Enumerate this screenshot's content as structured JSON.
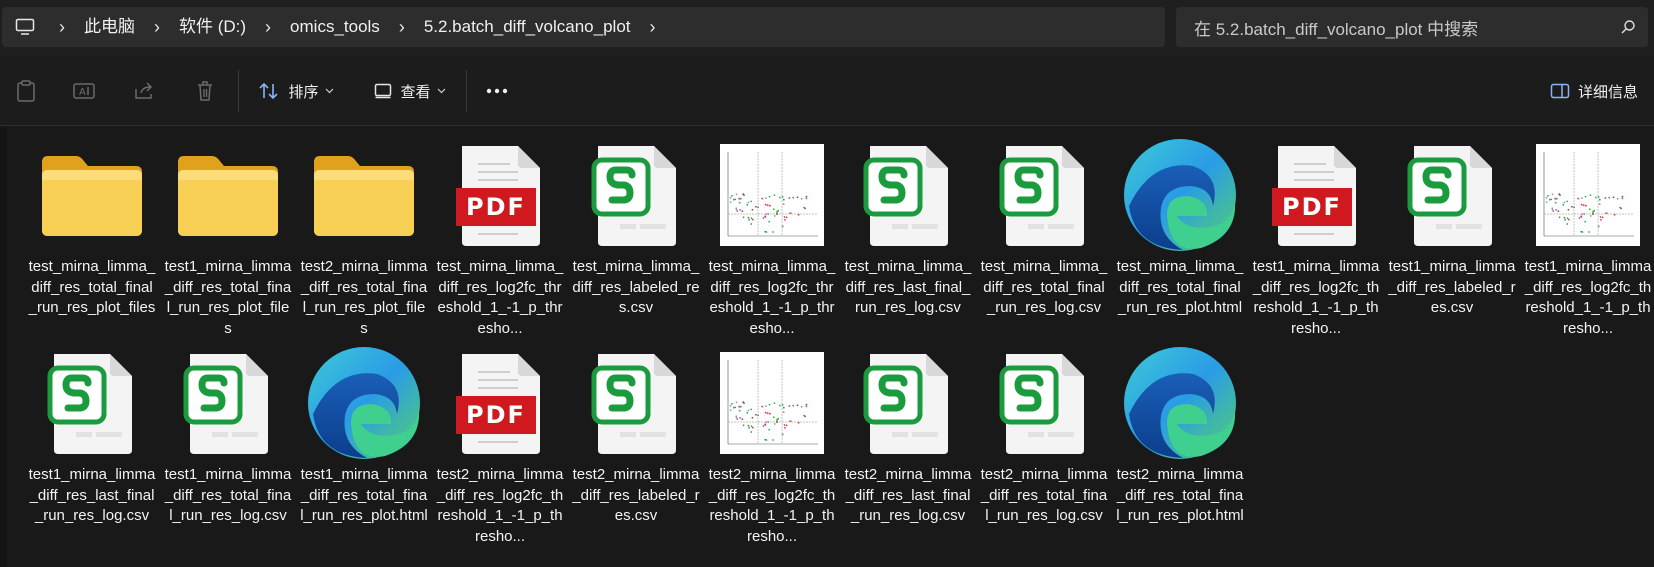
{
  "address": {
    "crumbs": [
      "此电脑",
      "软件 (D:)",
      "omics_tools",
      "5.2.batch_diff_volcano_plot"
    ],
    "search_placeholder": "在 5.2.batch_diff_volcano_plot 中搜索"
  },
  "toolbar": {
    "sort_label": "排序",
    "view_label": "查看",
    "details_label": "详细信息",
    "icons": [
      "paste-icon",
      "rename-icon",
      "share-icon",
      "delete-icon",
      "sort-icon",
      "view-icon",
      "more-icon",
      "details-pane-icon"
    ]
  },
  "files": [
    {
      "name": "test_mirna_limma_diff_res_total_final_run_res_plot_files",
      "type": "folder"
    },
    {
      "name": "test1_mirna_limma_diff_res_total_final_run_res_plot_files",
      "type": "folder"
    },
    {
      "name": "test2_mirna_limma_diff_res_total_final_run_res_plot_files",
      "type": "folder"
    },
    {
      "name": "test_mirna_limma_diff_res_log2fc_threshold_1_-1_p_thresho...",
      "type": "pdf"
    },
    {
      "name": "test_mirna_limma_diff_res_labeled_res.csv",
      "type": "csv"
    },
    {
      "name": "test_mirna_limma_diff_res_log2fc_threshold_1_-1_p_thresho...",
      "type": "png"
    },
    {
      "name": "test_mirna_limma_diff_res_last_final_run_res_log.csv",
      "type": "csv"
    },
    {
      "name": "test_mirna_limma_diff_res_total_final_run_res_log.csv",
      "type": "csv"
    },
    {
      "name": "test_mirna_limma_diff_res_total_final_run_res_plot.html",
      "type": "html"
    },
    {
      "name": "test1_mirna_limma_diff_res_log2fc_threshold_1_-1_p_thresho...",
      "type": "pdf"
    },
    {
      "name": "test1_mirna_limma_diff_res_labeled_res.csv",
      "type": "csv"
    },
    {
      "name": "test1_mirna_limma_diff_res_log2fc_threshold_1_-1_p_thresho...",
      "type": "png"
    },
    {
      "name": "test1_mirna_limma_diff_res_last_final_run_res_log.csv",
      "type": "csv"
    },
    {
      "name": "test1_mirna_limma_diff_res_total_final_run_res_log.csv",
      "type": "csv"
    },
    {
      "name": "test1_mirna_limma_diff_res_total_final_run_res_plot.html",
      "type": "html"
    },
    {
      "name": "test2_mirna_limma_diff_res_log2fc_threshold_1_-1_p_thresho...",
      "type": "pdf"
    },
    {
      "name": "test2_mirna_limma_diff_res_labeled_res.csv",
      "type": "csv"
    },
    {
      "name": "test2_mirna_limma_diff_res_log2fc_threshold_1_-1_p_thresho...",
      "type": "png"
    },
    {
      "name": "test2_mirna_limma_diff_res_last_final_run_res_log.csv",
      "type": "csv"
    },
    {
      "name": "test2_mirna_limma_diff_res_total_final_run_res_log.csv",
      "type": "csv"
    },
    {
      "name": "test2_mirna_limma_diff_res_total_final_run_res_plot.html",
      "type": "html"
    }
  ],
  "icon_text": {
    "pdf_badge": "PDF"
  },
  "colors": {
    "folder": "#f7c948",
    "pdf_red": "#d0191f",
    "csv_green": "#1a9c3e",
    "edge_blue": "#1f7ed6",
    "edge_green": "#3fcf8e"
  }
}
